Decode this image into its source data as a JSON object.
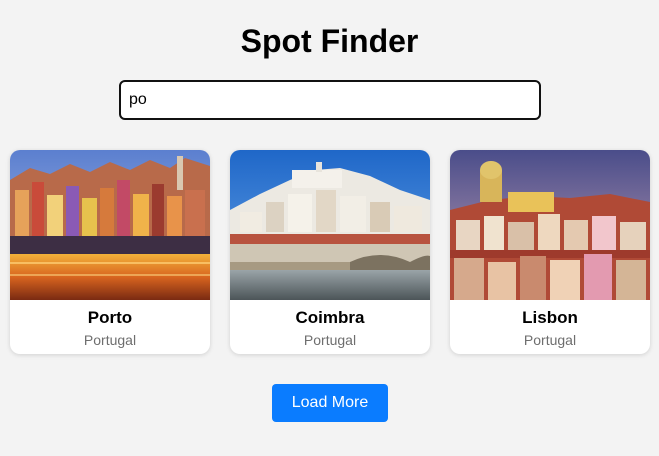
{
  "header": {
    "title": "Spot Finder"
  },
  "search": {
    "value": "po",
    "placeholder": ""
  },
  "results": [
    {
      "name": "Porto",
      "country": "Portugal"
    },
    {
      "name": "Coimbra",
      "country": "Portugal"
    },
    {
      "name": "Lisbon",
      "country": "Portugal"
    }
  ],
  "actions": {
    "load_more_label": "Load More"
  },
  "colors": {
    "background": "#f3f3f3",
    "accent": "#0a7cff",
    "subtitle": "#6e6e6e"
  }
}
